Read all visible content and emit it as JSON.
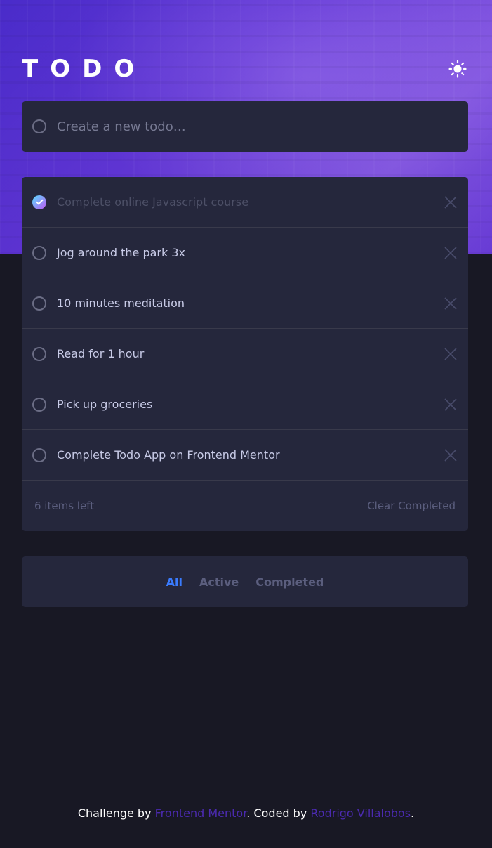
{
  "app": {
    "logo": "TODO"
  },
  "new_todo": {
    "placeholder": "Create a new todo…",
    "value": ""
  },
  "todos": [
    {
      "text": "Complete online Javascript course",
      "completed": true
    },
    {
      "text": "Jog around the park 3x",
      "completed": false
    },
    {
      "text": "10 minutes meditation",
      "completed": false
    },
    {
      "text": "Read for 1 hour",
      "completed": false
    },
    {
      "text": "Pick up groceries",
      "completed": false
    },
    {
      "text": "Complete Todo App on Frontend Mentor",
      "completed": false
    }
  ],
  "footer": {
    "items_left": "6 items left",
    "clear_label": "Clear Completed"
  },
  "filters": {
    "all": "All",
    "active": "Active",
    "completed": "Completed",
    "selected": "All"
  },
  "attribution": {
    "prefix": "Challenge by ",
    "link1": "Frontend Mentor",
    "middle": ". Coded by ",
    "link2": "Rodrigo Villalobos",
    "suffix": "."
  },
  "icons": {
    "theme": "sun-icon",
    "check": "check-icon",
    "delete": "cross-icon"
  },
  "colors": {
    "background": "#181824",
    "card": "#25273c",
    "accent": "#3a7bfd",
    "check_gradient_start": "#57ddff",
    "check_gradient_end": "#c058f3"
  }
}
